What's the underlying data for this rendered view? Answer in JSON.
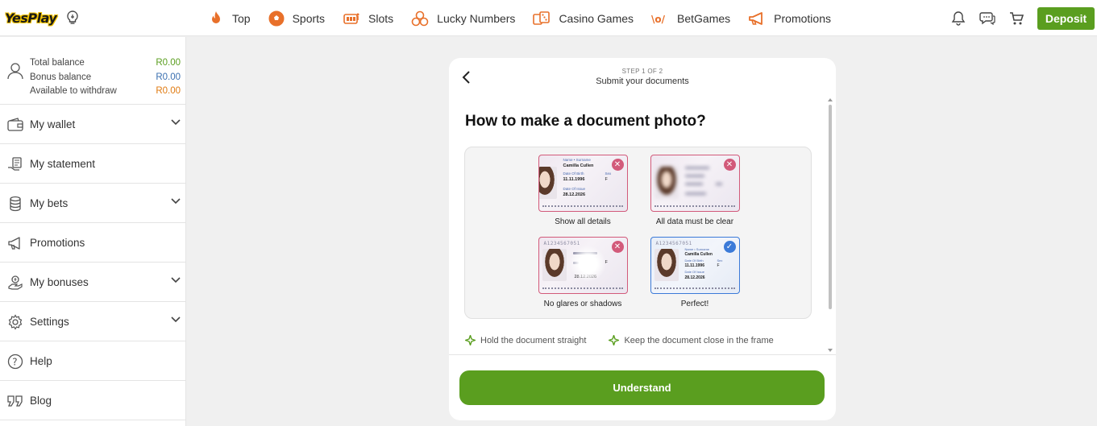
{
  "header": {
    "logo_text": "YesPlay",
    "nav": [
      {
        "label": "Top",
        "icon": "flame-icon"
      },
      {
        "label": "Sports",
        "icon": "soccer-ball-icon"
      },
      {
        "label": "Slots",
        "icon": "slot-machine-icon"
      },
      {
        "label": "Lucky Numbers",
        "icon": "lottery-balls-icon"
      },
      {
        "label": "Casino Games",
        "icon": "dice-icon"
      },
      {
        "label": "BetGames",
        "icon": "betgames-icon"
      },
      {
        "label": "Promotions",
        "icon": "megaphone-icon"
      }
    ],
    "deposit_label": "Deposit"
  },
  "sidebar": {
    "balances": [
      {
        "label": "Total balance",
        "value": "R0.00"
      },
      {
        "label": "Bonus balance",
        "value": "R0.00"
      },
      {
        "label": "Available to withdraw",
        "value": "R0.00"
      }
    ],
    "items": [
      {
        "label": "My wallet",
        "icon": "wallet-icon",
        "expandable": true
      },
      {
        "label": "My statement",
        "icon": "statement-icon",
        "expandable": false
      },
      {
        "label": "My bets",
        "icon": "coins-icon",
        "expandable": true
      },
      {
        "label": "Promotions",
        "icon": "megaphone-icon",
        "expandable": false
      },
      {
        "label": "My bonuses",
        "icon": "bonus-icon",
        "expandable": true
      },
      {
        "label": "Settings",
        "icon": "gear-icon",
        "expandable": true
      },
      {
        "label": "Help",
        "icon": "help-icon",
        "expandable": false
      },
      {
        "label": "Blog",
        "icon": "quote-icon",
        "expandable": false
      }
    ]
  },
  "modal": {
    "step": "STEP 1 OF 2",
    "step_title": "Submit your documents",
    "title": "How to make a document photo?",
    "examples": [
      {
        "label": "Show all details",
        "status": "bad"
      },
      {
        "label": "All data must be clear",
        "status": "bad"
      },
      {
        "label": "No glares or shadows",
        "status": "bad"
      },
      {
        "label": "Perfect!",
        "status": "good"
      }
    ],
    "card_text": {
      "name_label": "Name • Surname",
      "name": "Camilla Cullen",
      "dob_label": "Date Of Birth",
      "dob": "11.11.1996",
      "sex_label": "Sex",
      "sex": "F",
      "issue_label": "Date Of Issue",
      "issue": "28.12.2026",
      "doc_number": "A1234567051"
    },
    "tips": [
      "Hold the document straight",
      "Keep the document close in the frame"
    ],
    "button_label": "Understand"
  },
  "colors": {
    "brand_green": "#5a9e1f",
    "bad_red": "#d25a7a",
    "good_blue": "#3b7ad8",
    "nav_orange": "#e8702a"
  }
}
